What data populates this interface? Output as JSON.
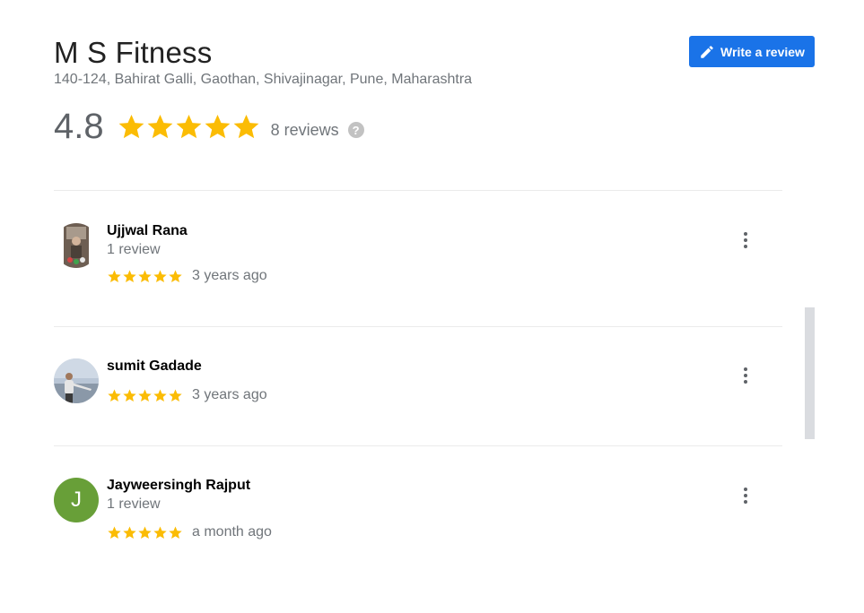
{
  "business": {
    "name": "M S Fitness",
    "address": "140-124, Bahirat Galli, Gaothan, Shivajinagar, Pune, Maharashtra",
    "rating": "4.8",
    "rating_stars": 5,
    "review_count": "8 reviews",
    "help_glyph": "?"
  },
  "actions": {
    "write_review_label": "Write a review",
    "write_review_icon": "pencil-icon"
  },
  "colors": {
    "accent": "#1a73e8",
    "star": "#fbbc04",
    "avatar_j": "#689f38"
  },
  "reviews": [
    {
      "name": "Ujjwal Rana",
      "meta": "1 review",
      "stars": 5,
      "date": "3 years ago",
      "avatar": "photo"
    },
    {
      "name": "sumit Gadade",
      "meta": "",
      "stars": 5,
      "date": "3 years ago",
      "avatar": "photo"
    },
    {
      "name": "Jayweersingh Rajput",
      "meta": "1 review",
      "stars": 5,
      "date": "a month ago",
      "avatar_letter": "J"
    }
  ]
}
